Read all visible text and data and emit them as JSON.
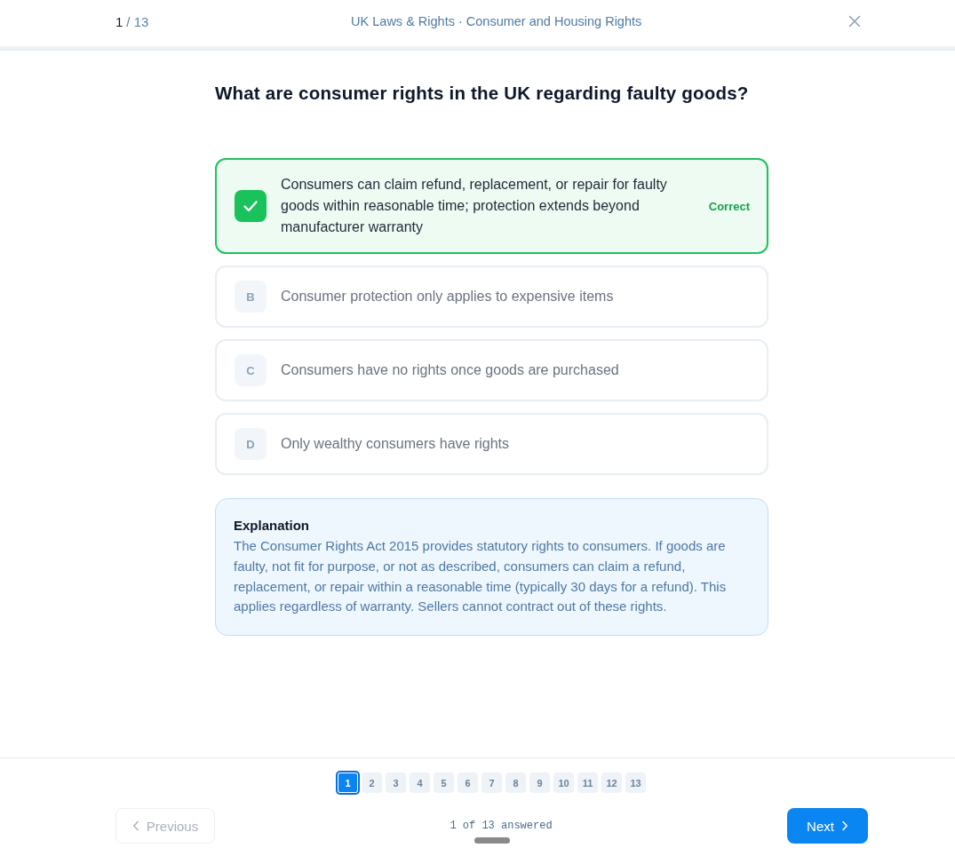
{
  "header": {
    "counter": {
      "current": "1",
      "total": "/ 13"
    },
    "title": "UK Laws & Rights · Consumer and Housing Rights"
  },
  "question": "What are consumer rights in the UK regarding faulty goods?",
  "options": [
    {
      "text": "Consumers can claim refund, replacement, or repair for faulty goods within reasonable time; protection extends beyond manufacturer warranty",
      "correct": true,
      "disabled": false,
      "result": "Correct"
    },
    {
      "letter": "B",
      "text": "Consumer protection only applies to expensive items",
      "correct": false,
      "disabled": true
    },
    {
      "letter": "C",
      "text": "Consumers have no rights once goods are purchased",
      "correct": false,
      "disabled": true
    },
    {
      "letter": "D",
      "text": "Only wealthy consumers have rights",
      "correct": false,
      "disabled": true
    }
  ],
  "explanation": {
    "title": "Explanation",
    "text": "The Consumer Rights Act 2015 provides statutory rights to consumers. If goods are faulty, not fit for purpose, or not as described, consumers can claim a refund, replacement, or repair within a reasonable time (typically 30 days for a refund). This applies regardless of warranty. Sellers cannot contract out of these rights."
  },
  "pagination": [
    {
      "label": "1",
      "selected": true
    },
    {
      "label": "2",
      "selected": false
    },
    {
      "label": "3",
      "selected": false
    },
    {
      "label": "4",
      "selected": false
    },
    {
      "label": "5",
      "selected": false
    },
    {
      "label": "6",
      "selected": false
    },
    {
      "label": "7",
      "selected": false
    },
    {
      "label": "8",
      "selected": false
    },
    {
      "label": "9",
      "selected": false
    },
    {
      "label": "10",
      "selected": false
    },
    {
      "label": "11",
      "selected": false
    },
    {
      "label": "12",
      "selected": false
    },
    {
      "label": "13",
      "selected": false
    }
  ],
  "footer": {
    "previous": {
      "label": "Previous",
      "disabled": true
    },
    "progress": "1 of 13 answered",
    "next": {
      "label": "Next",
      "disabled": false
    }
  }
}
